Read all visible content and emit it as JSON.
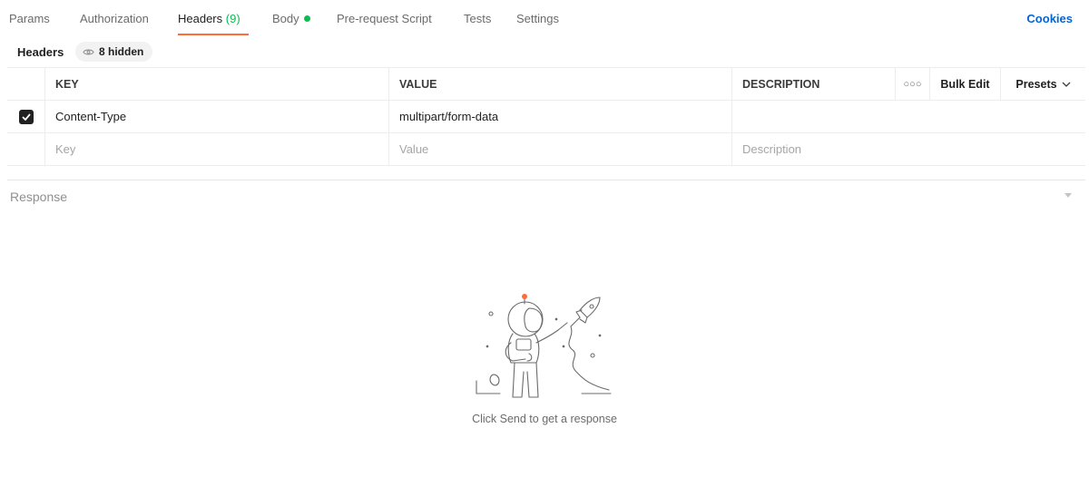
{
  "tabs": [
    {
      "label": "Params"
    },
    {
      "label": "Authorization"
    },
    {
      "label": "Headers",
      "count": "(9)"
    },
    {
      "label": "Body"
    },
    {
      "label": "Pre-request Script"
    },
    {
      "label": "Tests"
    },
    {
      "label": "Settings"
    }
  ],
  "active_tab": "Headers",
  "cookies_label": "Cookies",
  "headers_section": {
    "title": "Headers",
    "hidden_label": "8 hidden"
  },
  "table": {
    "columns": {
      "key": "KEY",
      "value": "VALUE",
      "description": "DESCRIPTION"
    },
    "bulk_edit_label": "Bulk Edit",
    "presets_label": "Presets",
    "rows": [
      {
        "checked": true,
        "key": "Content-Type",
        "value": "multipart/form-data",
        "description": ""
      }
    ],
    "placeholders": {
      "key": "Key",
      "value": "Value",
      "description": "Description"
    }
  },
  "response": {
    "title": "Response",
    "empty_message": "Click Send to get a response"
  },
  "colors": {
    "accent": "#ff6c37",
    "body_dot": "#0cbb52",
    "link": "#0265d2"
  }
}
